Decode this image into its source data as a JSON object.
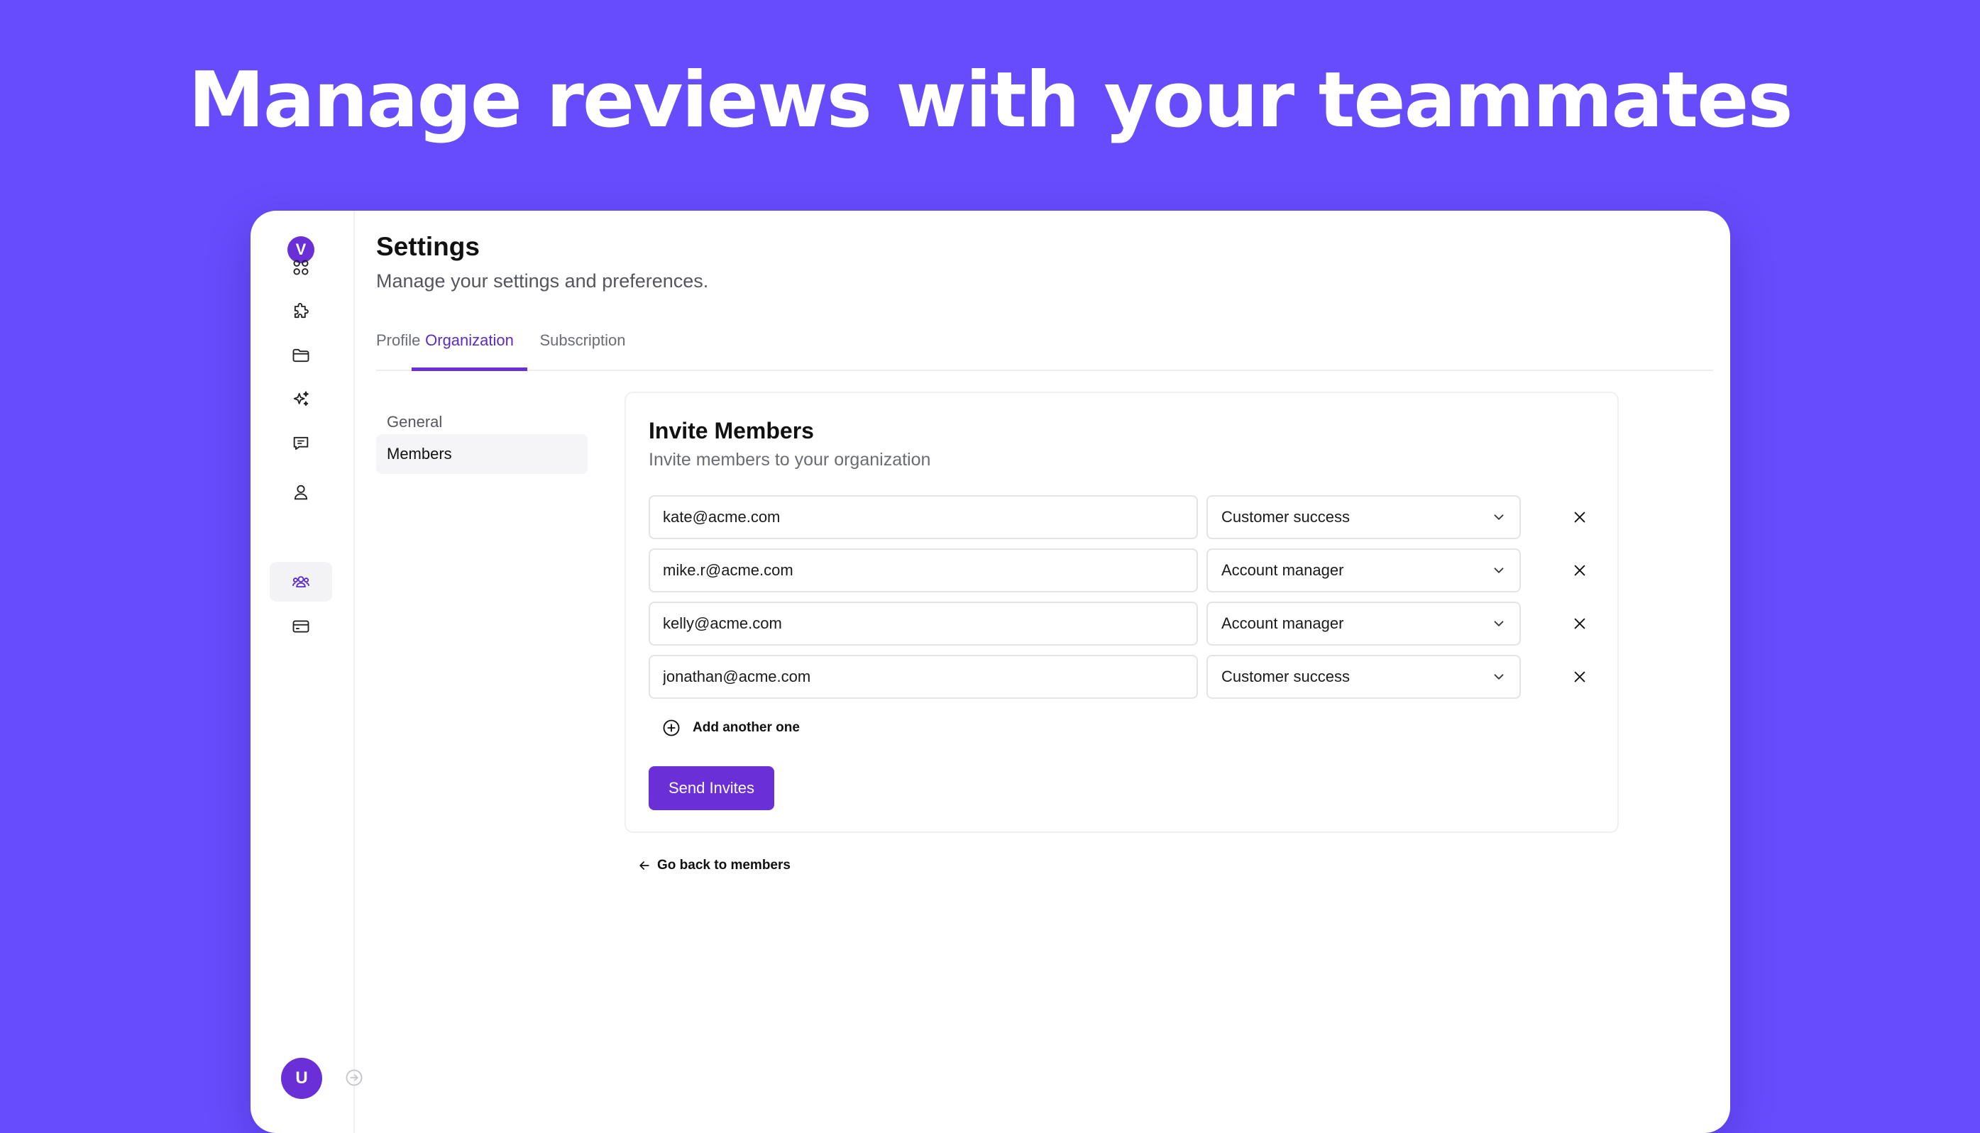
{
  "hero": {
    "headline": "Manage reviews with your teammates"
  },
  "sidebar": {
    "logo_letter": "V",
    "avatar_letter": "U",
    "items": [
      {
        "icon": "grid-icon"
      },
      {
        "icon": "puzzle-icon"
      },
      {
        "icon": "folder-icon"
      },
      {
        "icon": "sparkles-icon"
      },
      {
        "icon": "message-icon"
      },
      {
        "icon": "user-icon"
      },
      {
        "icon": "team-icon",
        "active": true
      },
      {
        "icon": "credit-card-icon"
      }
    ]
  },
  "page": {
    "title": "Settings",
    "subtitle": "Manage your settings and preferences."
  },
  "tabs": [
    {
      "label": "Profile"
    },
    {
      "label": "Organization",
      "active": true
    },
    {
      "label": "Subscription"
    }
  ],
  "subnav": [
    {
      "label": "General"
    },
    {
      "label": "Members",
      "active": true
    }
  ],
  "invite": {
    "title": "Invite Members",
    "subtitle": "Invite members to your organization",
    "rows": [
      {
        "email": "kate@acme.com",
        "role": "Customer success"
      },
      {
        "email": "mike.r@acme.com",
        "role": "Account manager"
      },
      {
        "email": "kelly@acme.com",
        "role": "Account manager"
      },
      {
        "email": "jonathan@acme.com",
        "role": "Customer success"
      }
    ],
    "add_label": "Add another one",
    "send_label": "Send Invites"
  },
  "back_label": "Go back to members",
  "colors": {
    "background": "#674cfd",
    "accent": "#6a2fd6"
  }
}
